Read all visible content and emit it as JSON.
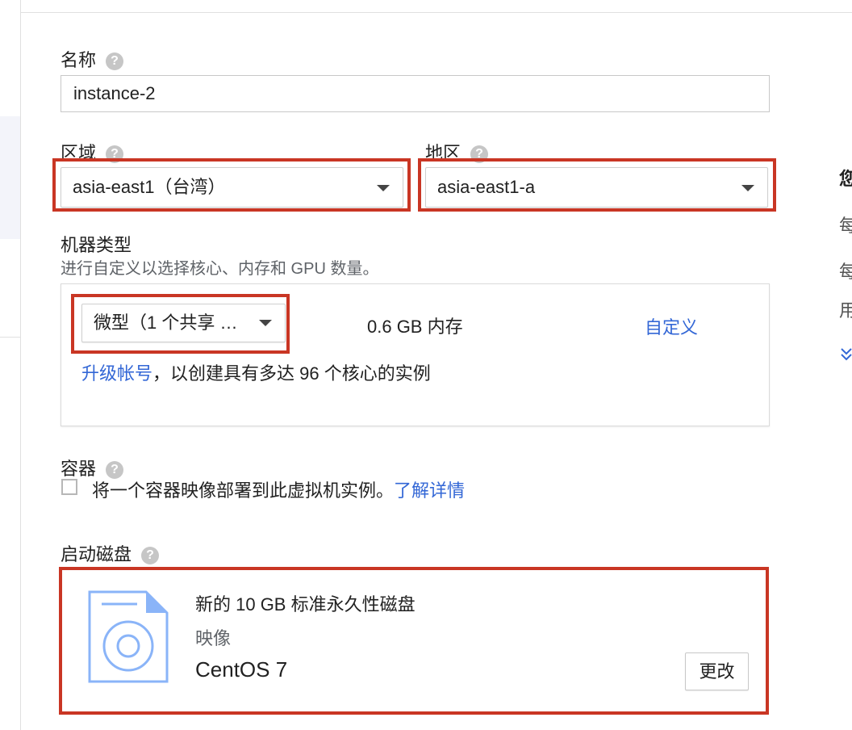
{
  "name_section": {
    "label": "名称",
    "value": "instance-2"
  },
  "region": {
    "label": "区域",
    "selected": "asia-east1（台湾）"
  },
  "zone": {
    "label": "地区",
    "selected": "asia-east1-a"
  },
  "machine_type": {
    "label": "机器类型",
    "description": "进行自定义以选择核心、内存和 GPU 数量。",
    "preset_selected": "微型（1 个共享 …",
    "memory": "0.6 GB 内存",
    "customize_link": "自定义",
    "upgrade_link": "升级帐号",
    "upgrade_text": "，以创建具有多达 96 个核心的实例"
  },
  "container": {
    "label": "容器",
    "checkbox_text": "将一个容器映像部署到此虚拟机实例。",
    "learn_more_link": "了解详情"
  },
  "boot_disk": {
    "label": "启动磁盘",
    "disk_title": "新的 10 GB 标准永久性磁盘",
    "image_label": "映像",
    "image_value": "CentOS 7",
    "change_button": "更改"
  },
  "right_panel": {
    "heading_char": "您",
    "line1_char": "每",
    "line2_char": "每",
    "line3_char": "用",
    "expand_icon": "chevron-double-down-icon"
  },
  "icons": {
    "help": "help-icon",
    "disk": "disk-image-icon",
    "dropdown": "caret-down-icon"
  },
  "colors": {
    "highlight": "#c93624",
    "link": "#3367d6",
    "icon_blue": "#8ab4f8"
  }
}
